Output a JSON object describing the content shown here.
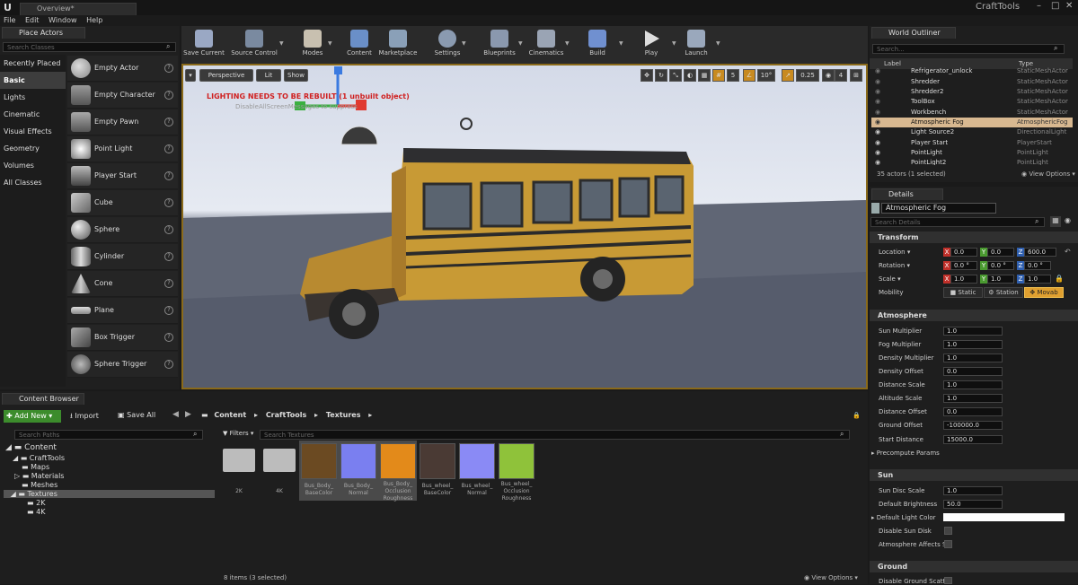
{
  "window": {
    "tab": "Overview*",
    "project": "CraftTools"
  },
  "menu": [
    "File",
    "Edit",
    "Window",
    "Help"
  ],
  "place_actors": {
    "tab": "Place Actors",
    "search_placeholder": "Search Classes",
    "categories": [
      "Recently Placed",
      "Basic",
      "Lights",
      "Cinematic",
      "Visual Effects",
      "Geometry",
      "Volumes",
      "All Classes"
    ],
    "items": [
      "Empty Actor",
      "Empty Character",
      "Empty Pawn",
      "Point Light",
      "Player Start",
      "Cube",
      "Sphere",
      "Cylinder",
      "Cone",
      "Plane",
      "Box Trigger",
      "Sphere Trigger"
    ]
  },
  "toolbar": [
    "Save Current",
    "Source Control",
    "Modes",
    "Content",
    "Marketplace",
    "Settings",
    "Blueprints",
    "Cinematics",
    "Build",
    "Play",
    "Launch"
  ],
  "viewport": {
    "perspective": "Perspective",
    "lit": "Lit",
    "show": "Show",
    "warning": "LIGHTING NEEDS TO BE REBUILT (1 unbuilt object)",
    "sub": "DisableAllScreenMessages to suppress",
    "grid": "5",
    "angle": "10°",
    "scale": "0.25",
    "cam": "4"
  },
  "outliner": {
    "tab": "World Outliner",
    "search_placeholder": "Search...",
    "col_label": "Label",
    "col_type": "Type",
    "rows": [
      {
        "name": "Refrigerator_unlock",
        "type": "StaticMeshActor"
      },
      {
        "name": "Shredder",
        "type": "StaticMeshActor"
      },
      {
        "name": "Shredder2",
        "type": "StaticMeshActor"
      },
      {
        "name": "ToolBox",
        "type": "StaticMeshActor"
      },
      {
        "name": "Workbench",
        "type": "StaticMeshActor"
      },
      {
        "name": "Atmospheric Fog",
        "type": "AtmosphericFog"
      },
      {
        "name": "Light Source2",
        "type": "DirectionalLight"
      },
      {
        "name": "Player Start",
        "type": "PlayerStart"
      },
      {
        "name": "PointLight",
        "type": "PointLight"
      },
      {
        "name": "PointLight2",
        "type": "PointLight"
      }
    ],
    "status": "35 actors (1 selected)",
    "view_options": "View Options"
  },
  "details": {
    "tab": "Details",
    "object": "Atmospheric Fog",
    "search_placeholder": "Search Details",
    "transform": "Transform",
    "location": {
      "label": "Location",
      "x": "0.0",
      "y": "0.0",
      "z": "600.0"
    },
    "rotation": {
      "label": "Rotation",
      "x": "0.0 °",
      "y": "0.0 °",
      "z": "0.0 °"
    },
    "scale": {
      "label": "Scale",
      "x": "1.0",
      "y": "1.0",
      "z": "1.0"
    },
    "mobility": {
      "label": "Mobility",
      "static": "Static",
      "station": "Station",
      "movable": "Movab"
    },
    "atmosphere": "Atmosphere",
    "atm_props": [
      {
        "label": "Sun Multiplier",
        "value": "1.0"
      },
      {
        "label": "Fog Multiplier",
        "value": "1.0"
      },
      {
        "label": "Density Multiplier",
        "value": "1.0"
      },
      {
        "label": "Density Offset",
        "value": "0.0"
      },
      {
        "label": "Distance Scale",
        "value": "1.0"
      },
      {
        "label": "Altitude Scale",
        "value": "1.0"
      },
      {
        "label": "Distance Offset",
        "value": "0.0"
      },
      {
        "label": "Ground Offset",
        "value": "-100000.0"
      },
      {
        "label": "Start Distance",
        "value": "15000.0"
      }
    ],
    "precompute": "Precompute Params",
    "sun": "Sun",
    "sun_disc": {
      "label": "Sun Disc Scale",
      "value": "1.0"
    },
    "brightness": {
      "label": "Default Brightness",
      "value": "50.0"
    },
    "light_color": "Default Light Color",
    "disable_sun": "Disable Sun Disk",
    "atm_affects": "Atmosphere Affects S",
    "ground": "Ground",
    "disable_ground": "Disable Ground Scatte"
  },
  "content_browser": {
    "tab": "Content Browser",
    "add_new": "Add New",
    "import": "Import",
    "save_all": "Save All",
    "path": [
      "Content",
      "CraftTools",
      "Textures"
    ],
    "search_paths": "Search Paths",
    "filters": "Filters",
    "search_textures": "Search Textures",
    "tree": [
      "Content",
      "CraftTools",
      "Maps",
      "Materials",
      "Meshes",
      "Textures",
      "2K",
      "4K"
    ],
    "folders": [
      "2K",
      "4K"
    ],
    "assets": [
      {
        "l1": "Bus_Body_",
        "l2": "BaseColor",
        "l3": "",
        "color": "#6b4a22"
      },
      {
        "l1": "Bus_Body_",
        "l2": "Normal",
        "l3": "",
        "color": "#7a7ff0"
      },
      {
        "l1": "Bus_Body_",
        "l2": "Occlusion",
        "l3": "Roughness",
        "color": "#e38a1a"
      },
      {
        "l1": "Bus_wheel_",
        "l2": "BaseColor",
        "l3": "",
        "color": "#4a3a34"
      },
      {
        "l1": "Bus_wheel_",
        "l2": "Normal",
        "l3": "",
        "color": "#8a8af5"
      },
      {
        "l1": "Bus_wheel_",
        "l2": "Occlusion",
        "l3": "Roughness",
        "color": "#8fc23a"
      }
    ],
    "status": "8 items (3 selected)",
    "view_options": "View Options"
  }
}
